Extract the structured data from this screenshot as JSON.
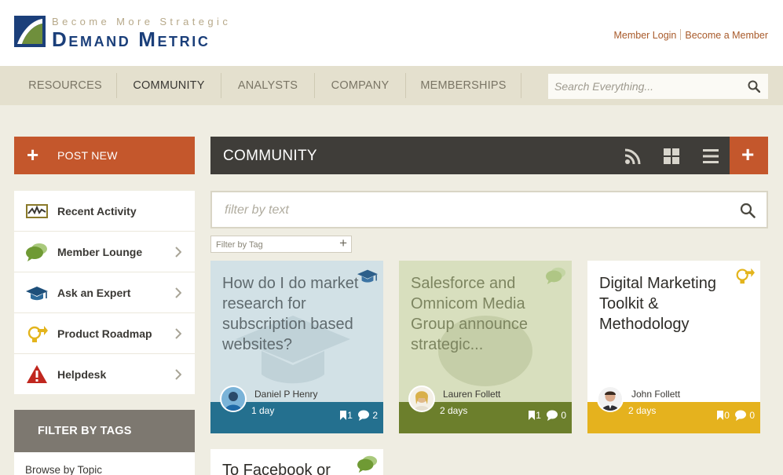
{
  "header": {
    "tagline": "Become More Strategic",
    "brand": "Demand Metric",
    "member_login": "Member Login",
    "become_member": "Become a Member"
  },
  "nav": {
    "items": [
      "RESOURCES",
      "COMMUNITY",
      "ANALYSTS",
      "COMPANY",
      "MEMBERSHIPS"
    ],
    "active": "COMMUNITY",
    "search_placeholder": "Search Everything..."
  },
  "sidebar": {
    "post_new": "POST NEW",
    "items": [
      {
        "label": "Recent Activity",
        "icon": "activity-icon"
      },
      {
        "label": "Member Lounge",
        "icon": "chat-bubbles-icon"
      },
      {
        "label": "Ask an Expert",
        "icon": "graduation-cap-icon"
      },
      {
        "label": "Product Roadmap",
        "icon": "lightbulb-arrow-icon"
      },
      {
        "label": "Helpdesk",
        "icon": "warning-icon"
      }
    ],
    "filter_by_tags": "FILTER BY TAGS",
    "browse_by_topic": "Browse by Topic"
  },
  "community": {
    "title": "COMMUNITY",
    "filter_placeholder": "filter by text",
    "tag_placeholder": "Filter by Tag"
  },
  "cards": [
    {
      "title": "How do I do market research for subscription based websites?",
      "author": "Daniel P Henry",
      "when": "1 day",
      "bookmarks": "1",
      "comments": "2",
      "icon": "graduation-cap-icon"
    },
    {
      "title": "Salesforce and Omnicom Media Group announce strategic...",
      "author": "Lauren Follett",
      "when": "2 days",
      "bookmarks": "1",
      "comments": "0",
      "icon": "chat-bubbles-icon"
    },
    {
      "title": "Digital Marketing Toolkit & Methodology",
      "author": "John Follett",
      "when": "2 days",
      "bookmarks": "0",
      "comments": "0",
      "icon": "lightbulb-arrow-icon"
    },
    {
      "title": "To Facebook or",
      "icon": "chat-bubbles-icon"
    }
  ],
  "colors": {
    "accent": "#c4572c",
    "nav_bg": "#e4e0ce",
    "page_bg": "#efede2",
    "dark_bar": "#3f3d39",
    "brand_blue": "#1b3f7a"
  }
}
